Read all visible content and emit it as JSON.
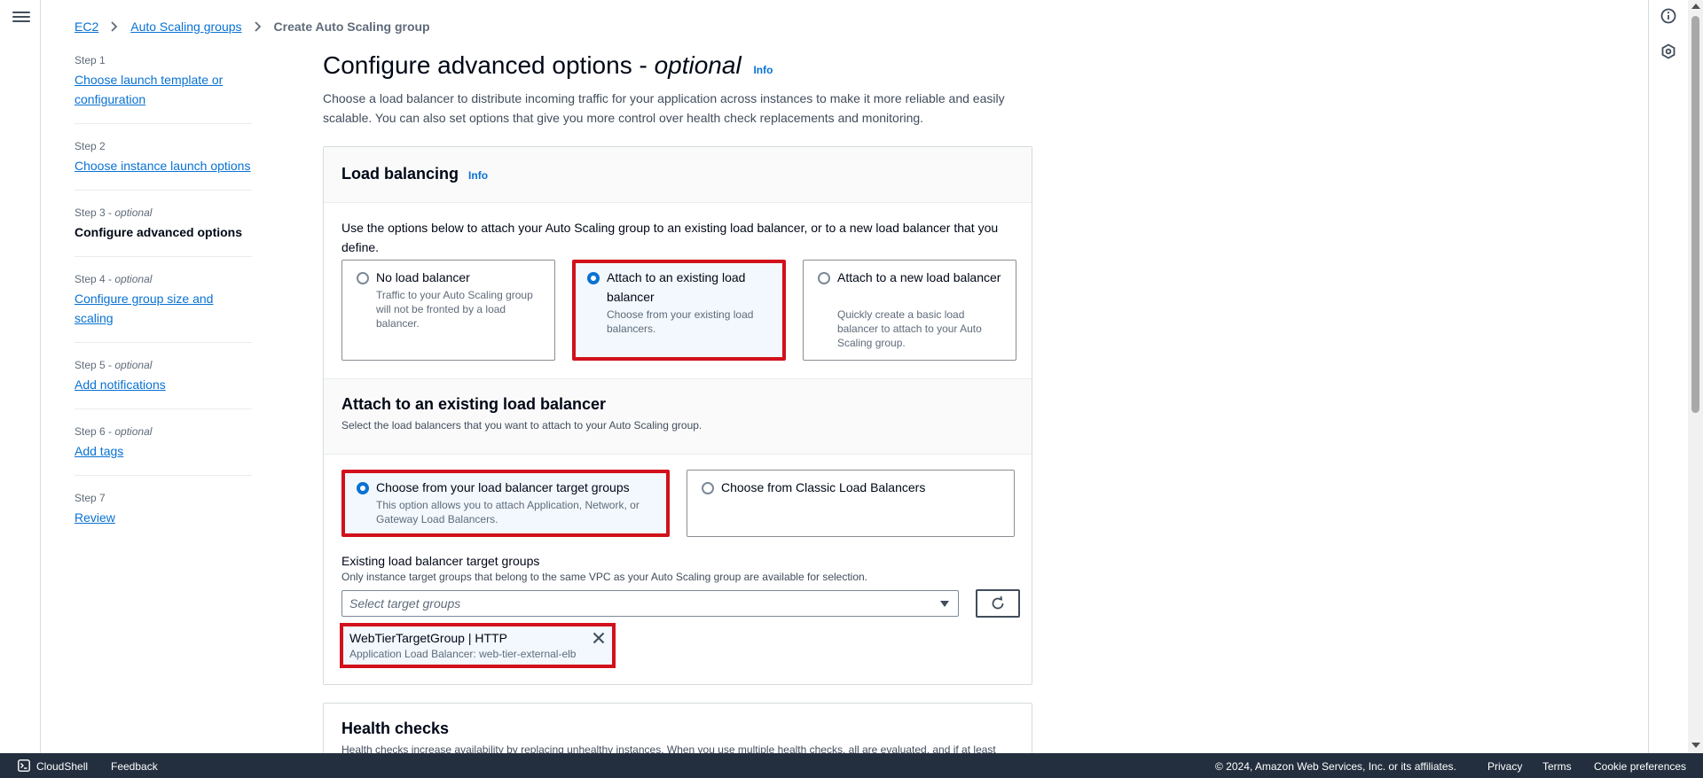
{
  "breadcrumb": {
    "items": [
      "EC2",
      "Auto Scaling groups"
    ],
    "current": "Create Auto Scaling group"
  },
  "steps": [
    {
      "num": "Step 1",
      "optional": "",
      "title": "Choose launch template or configuration"
    },
    {
      "num": "Step 2",
      "optional": "",
      "title": "Choose instance launch options"
    },
    {
      "num": "Step 3",
      "optional": "optional",
      "title": "Configure advanced options"
    },
    {
      "num": "Step 4",
      "optional": "optional",
      "title": "Configure group size and scaling"
    },
    {
      "num": "Step 5",
      "optional": "optional",
      "title": "Add notifications"
    },
    {
      "num": "Step 6",
      "optional": "optional",
      "title": "Add tags"
    },
    {
      "num": "Step 7",
      "optional": "",
      "title": "Review"
    }
  ],
  "header": {
    "title": "Configure advanced options - ",
    "title_italic": "optional",
    "info": "Info",
    "description": "Choose a load balancer to distribute incoming traffic for your application across instances to make it more reliable and easily scalable. You can also set options that give you more control over health check replacements and monitoring."
  },
  "load_balancing": {
    "title": "Load balancing",
    "info": "Info",
    "intro": "Use the options below to attach your Auto Scaling group to an existing load balancer, or to a new load balancer that you define.",
    "options": [
      {
        "label": "No load balancer",
        "desc": "Traffic to your Auto Scaling group will not be fronted by a load balancer.",
        "selected": false
      },
      {
        "label": "Attach to an existing load balancer",
        "desc": "Choose from your existing load balancers.",
        "selected": true
      },
      {
        "label": "Attach to a new load balancer",
        "desc": "Quickly create a basic load balancer to attach to your Auto Scaling group.",
        "selected": false
      }
    ]
  },
  "existing_lb": {
    "title": "Attach to an existing load balancer",
    "subtitle": "Select the load balancers that you want to attach to your Auto Scaling group.",
    "options": [
      {
        "label": "Choose from your load balancer target groups",
        "desc": "This option allows you to attach Application, Network, or Gateway Load Balancers.",
        "selected": true
      },
      {
        "label": "Choose from Classic Load Balancers",
        "desc": "",
        "selected": false
      }
    ],
    "target_groups_label": "Existing load balancer target groups",
    "target_groups_desc": "Only instance target groups that belong to the same VPC as your Auto Scaling group are available for selection.",
    "select_placeholder": "Select target groups",
    "token": {
      "title": "WebTierTargetGroup | HTTP",
      "desc": "Application Load Balancer: web-tier-external-elb"
    }
  },
  "health_checks": {
    "title": "Health checks",
    "desc": "Health checks increase availability by replacing unhealthy instances. When you use multiple health checks, all are evaluated, and if at least"
  },
  "footer": {
    "cloudshell": "CloudShell",
    "feedback": "Feedback",
    "copyright": "© 2024, Amazon Web Services, Inc. or its affiliates.",
    "privacy": "Privacy",
    "terms": "Terms",
    "cookies": "Cookie preferences"
  },
  "colors": {
    "link": "#0972d3",
    "highlight": "#d1111b",
    "footer_bg": "#232f3e"
  }
}
